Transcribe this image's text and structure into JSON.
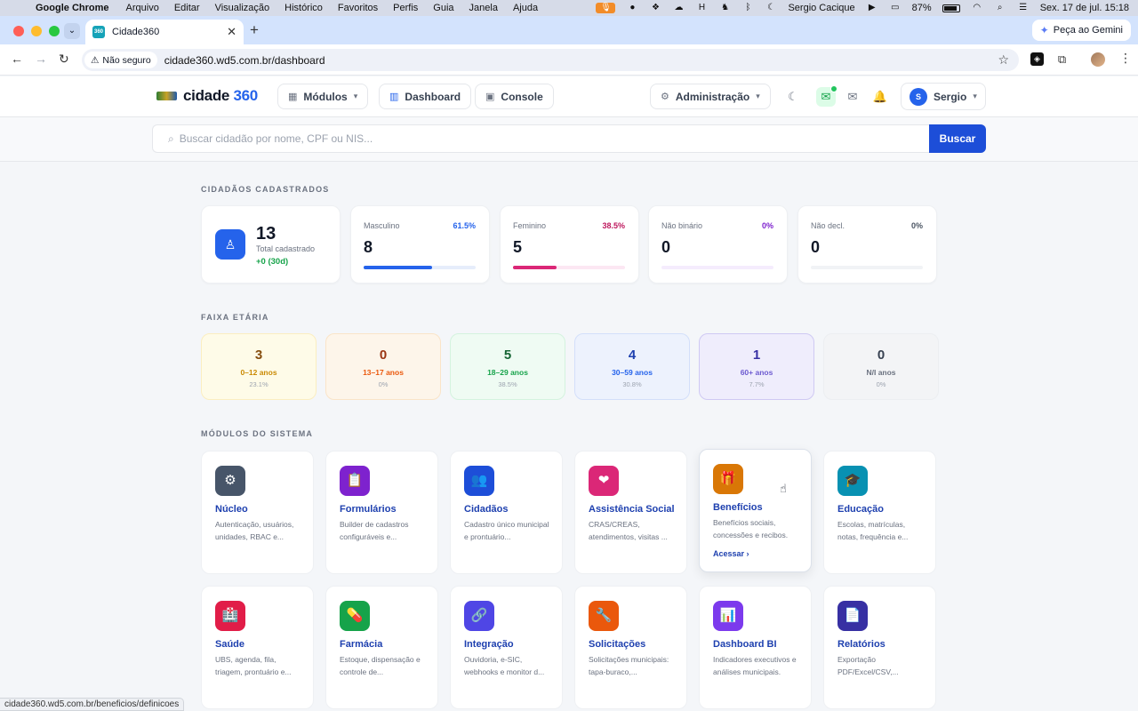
{
  "menubar": {
    "app_name": "Google Chrome",
    "items": [
      "Arquivo",
      "Editar",
      "Visualização",
      "Histórico",
      "Favoritos",
      "Perfis",
      "Guia",
      "Janela",
      "Ajuda"
    ],
    "user_name": "Sergio Cacique",
    "battery": "87%",
    "datetime": "Sex. 17 de jul.  15:18"
  },
  "browser": {
    "tab_title": "Cidade360",
    "tab_favicon_text": "360",
    "gemini_label": "Peça ao Gemini",
    "not_secure_label": "Não seguro",
    "url": "cidade360.wd5.com.br/dashboard",
    "status_url": "cidade360.wd5.com.br/beneficios/definicoes"
  },
  "header": {
    "brand_name": "cidade",
    "brand_suffix": "360",
    "modules_label": "Módulos",
    "dashboard_label": "Dashboard",
    "console_label": "Console",
    "admin_label": "Administração",
    "user_initial": "S",
    "user_name": "Sergio"
  },
  "search": {
    "placeholder": "Buscar cidadão por nome, CPF ou NIS...",
    "button_label": "Buscar"
  },
  "citizens": {
    "section_title": "CIDADÃOS CADASTRADOS",
    "total": {
      "value": "13",
      "label": "Total cadastrado",
      "delta": "+0 (30d)"
    },
    "genders": [
      {
        "label": "Masculino",
        "pct": "61.5%",
        "value": "8",
        "fraction": 0.615,
        "color": "#2563eb",
        "track": "#e6edfb",
        "pct_color": "#2563eb"
      },
      {
        "label": "Feminino",
        "pct": "38.5%",
        "value": "5",
        "fraction": 0.385,
        "color": "#db2777",
        "track": "#fce7f3",
        "pct_color": "#be185d"
      },
      {
        "label": "Não binário",
        "pct": "0%",
        "value": "0",
        "fraction": 0,
        "color": "#9333ea",
        "track": "#f5ecfd",
        "pct_color": "#7e22ce"
      },
      {
        "label": "Não decl.",
        "pct": "0%",
        "value": "0",
        "fraction": 0,
        "color": "#6b7280",
        "track": "#f1f3f6",
        "pct_color": "#4b5563"
      }
    ]
  },
  "ages": {
    "section_title": "FAIXA ETÁRIA",
    "items": [
      {
        "value": "3",
        "label": "0–12 anos",
        "pct": "23.1%",
        "bg": "#fefbe8",
        "border": "#fbeec0",
        "num_color": "#854d0e",
        "label_color": "#ca8a04"
      },
      {
        "value": "0",
        "label": "13–17 anos",
        "pct": "0%",
        "bg": "#fdf5ea",
        "border": "#fae4c8",
        "num_color": "#9a3412",
        "label_color": "#ea580c"
      },
      {
        "value": "5",
        "label": "18–29 anos",
        "pct": "38.5%",
        "bg": "#effbf3",
        "border": "#d4f3de",
        "num_color": "#166534",
        "label_color": "#16a34a"
      },
      {
        "value": "4",
        "label": "30–59 anos",
        "pct": "30.8%",
        "bg": "#edf2fd",
        "border": "#d3dffa",
        "num_color": "#1e40af",
        "label_color": "#2563eb"
      },
      {
        "value": "1",
        "label": "60+ anos",
        "pct": "7.7%",
        "bg": "#efedfc",
        "border": "#cfc9f3",
        "num_color": "#3730a3",
        "label_color": "#6d5bd0"
      },
      {
        "value": "0",
        "label": "N/I anos",
        "pct": "0%",
        "bg": "#f3f4f6",
        "border": "#eceef1",
        "num_color": "#374151",
        "label_color": "#6b7280"
      }
    ]
  },
  "modules": {
    "section_title": "MÓDULOS DO SISTEMA",
    "access_label": "Acessar",
    "items": [
      {
        "title": "Núcleo",
        "desc": "Autenticação, usuários, unidades, RBAC e...",
        "icon": "gear-icon",
        "glyph": "⚙",
        "color": "#475569"
      },
      {
        "title": "Formulários",
        "desc": "Builder de cadastros configuráveis e...",
        "icon": "clipboard-icon",
        "glyph": "📋",
        "color": "#7e22ce"
      },
      {
        "title": "Cidadãos",
        "desc": "Cadastro único municipal e prontuário...",
        "icon": "people-icon",
        "glyph": "👥",
        "color": "#1d4ed8"
      },
      {
        "title": "Assistência Social",
        "desc": "CRAS/CREAS, atendimentos, visitas ...",
        "icon": "heart-icon",
        "glyph": "❤",
        "color": "#db2777"
      },
      {
        "title": "Benefícios",
        "desc": "Benefícios sociais, concessões e recibos.",
        "icon": "gift-icon",
        "glyph": "🎁",
        "color": "#d97706"
      },
      {
        "title": "Educação",
        "desc": "Escolas, matrículas, notas, frequência e...",
        "icon": "graduation-cap-icon",
        "glyph": "🎓",
        "color": "#0891b2"
      },
      {
        "title": "Saúde",
        "desc": "UBS, agenda, fila, triagem, prontuário e...",
        "icon": "hospital-icon",
        "glyph": "🏥",
        "color": "#e11d48"
      },
      {
        "title": "Farmácia",
        "desc": "Estoque, dispensação e controle de...",
        "icon": "pill-icon",
        "glyph": "💊",
        "color": "#16a34a"
      },
      {
        "title": "Integração",
        "desc": "Ouvidoria, e-SIC, webhooks e monitor d...",
        "icon": "link-icon",
        "glyph": "🔗",
        "color": "#4f46e5"
      },
      {
        "title": "Solicitações",
        "desc": "Solicitações municipais: tapa-buraco,...",
        "icon": "wrench-icon",
        "glyph": "🔧",
        "color": "#ea580c"
      },
      {
        "title": "Dashboard BI",
        "desc": "Indicadores executivos e análises municipais.",
        "icon": "bar-chart-icon",
        "glyph": "📊",
        "color": "#7c3aed"
      },
      {
        "title": "Relatórios",
        "desc": "Exportação PDF/Excel/CSV,...",
        "icon": "document-icon",
        "glyph": "📄",
        "color": "#3730a3"
      }
    ]
  }
}
